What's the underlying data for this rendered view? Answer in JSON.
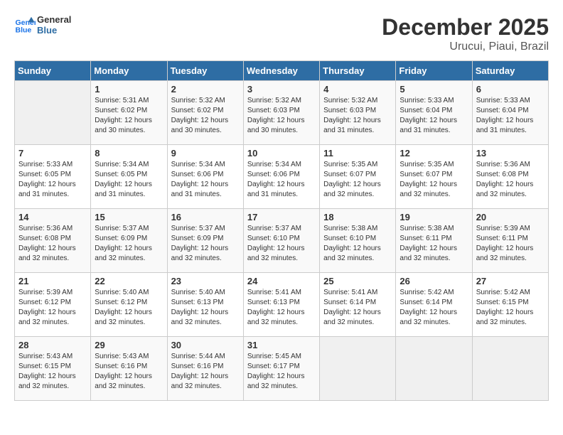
{
  "header": {
    "logo_line1": "General",
    "logo_line2": "Blue",
    "month": "December 2025",
    "location": "Urucui, Piaui, Brazil"
  },
  "weekdays": [
    "Sunday",
    "Monday",
    "Tuesday",
    "Wednesday",
    "Thursday",
    "Friday",
    "Saturday"
  ],
  "weeks": [
    [
      {
        "day": "",
        "info": ""
      },
      {
        "day": "1",
        "info": "Sunrise: 5:31 AM\nSunset: 6:02 PM\nDaylight: 12 hours\nand 30 minutes."
      },
      {
        "day": "2",
        "info": "Sunrise: 5:32 AM\nSunset: 6:02 PM\nDaylight: 12 hours\nand 30 minutes."
      },
      {
        "day": "3",
        "info": "Sunrise: 5:32 AM\nSunset: 6:03 PM\nDaylight: 12 hours\nand 30 minutes."
      },
      {
        "day": "4",
        "info": "Sunrise: 5:32 AM\nSunset: 6:03 PM\nDaylight: 12 hours\nand 31 minutes."
      },
      {
        "day": "5",
        "info": "Sunrise: 5:33 AM\nSunset: 6:04 PM\nDaylight: 12 hours\nand 31 minutes."
      },
      {
        "day": "6",
        "info": "Sunrise: 5:33 AM\nSunset: 6:04 PM\nDaylight: 12 hours\nand 31 minutes."
      }
    ],
    [
      {
        "day": "7",
        "info": "Sunrise: 5:33 AM\nSunset: 6:05 PM\nDaylight: 12 hours\nand 31 minutes."
      },
      {
        "day": "8",
        "info": "Sunrise: 5:34 AM\nSunset: 6:05 PM\nDaylight: 12 hours\nand 31 minutes."
      },
      {
        "day": "9",
        "info": "Sunrise: 5:34 AM\nSunset: 6:06 PM\nDaylight: 12 hours\nand 31 minutes."
      },
      {
        "day": "10",
        "info": "Sunrise: 5:34 AM\nSunset: 6:06 PM\nDaylight: 12 hours\nand 31 minutes."
      },
      {
        "day": "11",
        "info": "Sunrise: 5:35 AM\nSunset: 6:07 PM\nDaylight: 12 hours\nand 32 minutes."
      },
      {
        "day": "12",
        "info": "Sunrise: 5:35 AM\nSunset: 6:07 PM\nDaylight: 12 hours\nand 32 minutes."
      },
      {
        "day": "13",
        "info": "Sunrise: 5:36 AM\nSunset: 6:08 PM\nDaylight: 12 hours\nand 32 minutes."
      }
    ],
    [
      {
        "day": "14",
        "info": "Sunrise: 5:36 AM\nSunset: 6:08 PM\nDaylight: 12 hours\nand 32 minutes."
      },
      {
        "day": "15",
        "info": "Sunrise: 5:37 AM\nSunset: 6:09 PM\nDaylight: 12 hours\nand 32 minutes."
      },
      {
        "day": "16",
        "info": "Sunrise: 5:37 AM\nSunset: 6:09 PM\nDaylight: 12 hours\nand 32 minutes."
      },
      {
        "day": "17",
        "info": "Sunrise: 5:37 AM\nSunset: 6:10 PM\nDaylight: 12 hours\nand 32 minutes."
      },
      {
        "day": "18",
        "info": "Sunrise: 5:38 AM\nSunset: 6:10 PM\nDaylight: 12 hours\nand 32 minutes."
      },
      {
        "day": "19",
        "info": "Sunrise: 5:38 AM\nSunset: 6:11 PM\nDaylight: 12 hours\nand 32 minutes."
      },
      {
        "day": "20",
        "info": "Sunrise: 5:39 AM\nSunset: 6:11 PM\nDaylight: 12 hours\nand 32 minutes."
      }
    ],
    [
      {
        "day": "21",
        "info": "Sunrise: 5:39 AM\nSunset: 6:12 PM\nDaylight: 12 hours\nand 32 minutes."
      },
      {
        "day": "22",
        "info": "Sunrise: 5:40 AM\nSunset: 6:12 PM\nDaylight: 12 hours\nand 32 minutes."
      },
      {
        "day": "23",
        "info": "Sunrise: 5:40 AM\nSunset: 6:13 PM\nDaylight: 12 hours\nand 32 minutes."
      },
      {
        "day": "24",
        "info": "Sunrise: 5:41 AM\nSunset: 6:13 PM\nDaylight: 12 hours\nand 32 minutes."
      },
      {
        "day": "25",
        "info": "Sunrise: 5:41 AM\nSunset: 6:14 PM\nDaylight: 12 hours\nand 32 minutes."
      },
      {
        "day": "26",
        "info": "Sunrise: 5:42 AM\nSunset: 6:14 PM\nDaylight: 12 hours\nand 32 minutes."
      },
      {
        "day": "27",
        "info": "Sunrise: 5:42 AM\nSunset: 6:15 PM\nDaylight: 12 hours\nand 32 minutes."
      }
    ],
    [
      {
        "day": "28",
        "info": "Sunrise: 5:43 AM\nSunset: 6:15 PM\nDaylight: 12 hours\nand 32 minutes."
      },
      {
        "day": "29",
        "info": "Sunrise: 5:43 AM\nSunset: 6:16 PM\nDaylight: 12 hours\nand 32 minutes."
      },
      {
        "day": "30",
        "info": "Sunrise: 5:44 AM\nSunset: 6:16 PM\nDaylight: 12 hours\nand 32 minutes."
      },
      {
        "day": "31",
        "info": "Sunrise: 5:45 AM\nSunset: 6:17 PM\nDaylight: 12 hours\nand 32 minutes."
      },
      {
        "day": "",
        "info": ""
      },
      {
        "day": "",
        "info": ""
      },
      {
        "day": "",
        "info": ""
      }
    ]
  ]
}
